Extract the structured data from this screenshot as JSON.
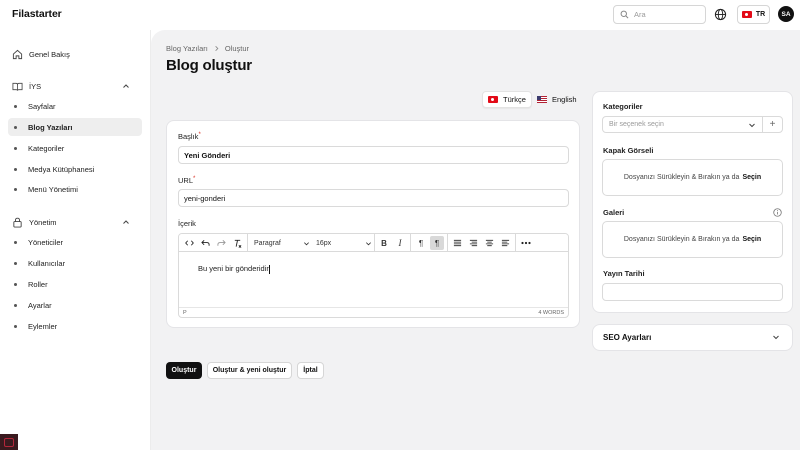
{
  "app": {
    "brand": "Filastarter"
  },
  "topbar": {
    "search_placeholder": "Ara",
    "language_label": "TR",
    "avatar_initials": "SA"
  },
  "sidebar": {
    "dashboard": "Genel Bakış",
    "cms_group": "İYS",
    "cms_items": [
      "Sayfalar",
      "Blog Yazıları",
      "Kategoriler",
      "Medya Kütüphanesi",
      "Menü Yönetimi"
    ],
    "admin_group": "Yönetim",
    "admin_items": [
      "Yöneticiler",
      "Kullanıcılar",
      "Roller",
      "Ayarlar",
      "Eylemler"
    ],
    "active_item": "Blog Yazıları"
  },
  "breadcrumb": [
    "Blog Yazıları",
    "Oluştur"
  ],
  "page_title": "Blog oluştur",
  "locales": [
    "Türkçe",
    "English"
  ],
  "form": {
    "title_label": "Başlık",
    "title_value": "Yeni Gönderi",
    "url_label": "URL",
    "url_value": "yeni-gonderi",
    "content_label": "İçerik",
    "editor": {
      "paragraph_select": "Paragraf",
      "font_size_select": "16px",
      "body_text": "Bu yeni bir gönderidir",
      "status_path": "P",
      "word_count": "4 WORDS"
    }
  },
  "side": {
    "categories_label": "Kategoriler",
    "categories_placeholder": "Bir seçenek seçin",
    "cover_label": "Kapak Görseli",
    "cover_drop_text": "Dosyanızı Sürükleyin & Bırakın ya da",
    "cover_drop_action": "Seçin",
    "gallery_label": "Galeri",
    "gallery_drop_text": "Dosyanızı Sürükleyin & Bırakın ya da",
    "gallery_drop_action": "Seçin",
    "publish_date_label": "Yayın Tarihi",
    "seo_label": "SEO Ayarları"
  },
  "actions": {
    "create": "Oluştur",
    "create_another": "Oluştur & yeni oluştur",
    "cancel": "İptal"
  },
  "colors": {
    "primary": "#111111",
    "background": "#f2f2f3",
    "required": "#d92d20"
  },
  "icons": [
    "search-icon",
    "globe-icon",
    "home-icon",
    "book-icon",
    "lock-icon",
    "chevron-up-icon",
    "chevron-down-icon",
    "info-icon",
    "plus-icon"
  ]
}
